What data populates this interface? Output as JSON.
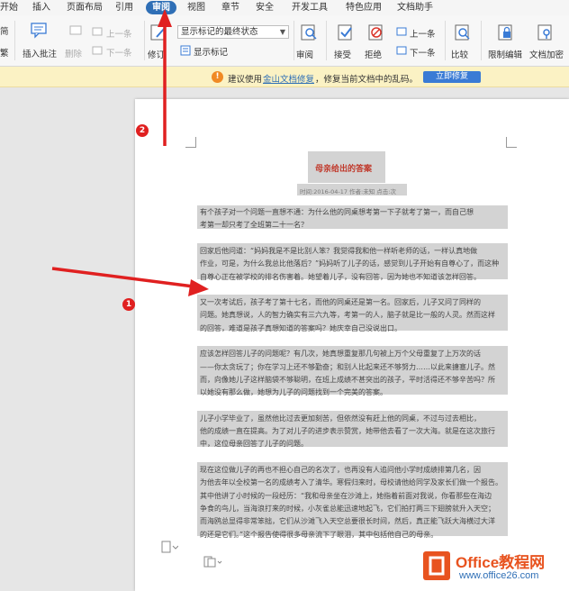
{
  "menu": {
    "items": [
      "开始",
      "插入",
      "页面布局",
      "引用",
      "审阅",
      "视图",
      "章节",
      "安全",
      "开发工具",
      "特色应用",
      "文档助手"
    ],
    "active_index": 4
  },
  "ribbon": {
    "left_cut_label_1": "简",
    "left_cut_label_2": "繁",
    "insert_comment": "插入批注",
    "delete": "删除",
    "prev_dim": "上一条",
    "next_dim": "下一条",
    "revise": "修订",
    "display_state": "显示标记的最终状态",
    "show_markup": "显示标记",
    "review": "审阅",
    "accept": "接受",
    "reject": "拒绝",
    "prev": "上一条",
    "next": "下一条",
    "compare": "比较",
    "restrict_edit": "限制编辑",
    "doc_encrypt": "文档加密"
  },
  "notice": {
    "prefix": "建议使用",
    "link": "金山文档修复",
    "suffix": "，修复当前文档中的乱码。",
    "button": "立即修复"
  },
  "document": {
    "title": "母亲给出的答案",
    "meta": "时间:2016-04-17  作者:未知  点击:次",
    "lines": [
      "有个孩子对一个问题一直想不通：为什么他的同桌想考第一下子就考了第一，而自己想",
      "考第一却只考了全班第二十一名？",
      "",
      "回家后他问道：“妈妈我是不是比别人笨？我觉得我和他一样听老师的话，一样认真地做",
      "作业，可是，为什么我总比他落后？”妈妈听了儿子的话，感觉到儿子开始有自尊心了，而这种",
      "自尊心正在被学校的排名伤害着。她望着儿子，没有回答，因为她也不知道该怎样回答。",
      "",
      "又一次考试后，孩子考了第十七名，而他的同桌还是第一名。回家后，儿子又问了同样的",
      "问题。她真想说，人的智力确实有三六九等，考第一的人，脑子就是比一般的人灵。然而这样",
      "的回答，难道是孩子真想知道的答案吗？她庆幸自己没说出口。",
      "",
      "应该怎样回答儿子的问题呢？有几次，她真想重复那几句被上万个父母重复了上万次的话",
      "——你太贪玩了；你在学习上还不够勤奋；和别人比起来还不够努力……以此来搪塞儿子。然",
      "而，向像她儿子这样脑袋不够聪明，在班上成绩不甚突出的孩子，平时活得还不够辛苦吗？所",
      "以她没有那么做，她想为儿子的问题找到一个完美的答案。",
      "",
      "儿子小学毕业了，虽然他比过去更加刻苦，但依然没有赶上他的同桌，不过与过去相比，",
      "他的成绩一直在提高。为了对儿子的进步表示赞赏，她带他去看了一次大海。就是在这次旅行",
      "中，这位母亲回答了儿子的问题。",
      "",
      "现在这位做儿子的再也不担心自己的名次了，也再没有人追问他小学时成绩排第几名，因",
      "为他去年以全校第一名的成绩考入了清华。寒假归来时，母校请他给同学及家长们做一个报告。",
      "其中他讲了小时候的一段经历：“我和母亲坐在沙滩上，她指着前面对我说，你看那些在海边",
      "争食的鸟儿，当海浪打来的时候，小灰雀总能迅速地起飞，它们拍打两三下翅膀就升入天空；",
      "而海鸥总显得非常笨拙，它们从沙滩飞入天空总要很长时间，然后，真正能飞跃大海横过大洋",
      "的还是它们。”这个报告使得很多母亲流下了眼泪，其中包括他自己的母亲。"
    ]
  },
  "annotations": {
    "badge_1": "1",
    "badge_2": "2"
  },
  "watermark": {
    "brand": "Office教程网",
    "url": "www.office26.com"
  },
  "colors": {
    "active_tab": "#2f6fb6",
    "arrow": "#e02020",
    "notice_bg": "#fbf2c4",
    "selection": "#d3d3d3",
    "logo": "#e8531f"
  }
}
